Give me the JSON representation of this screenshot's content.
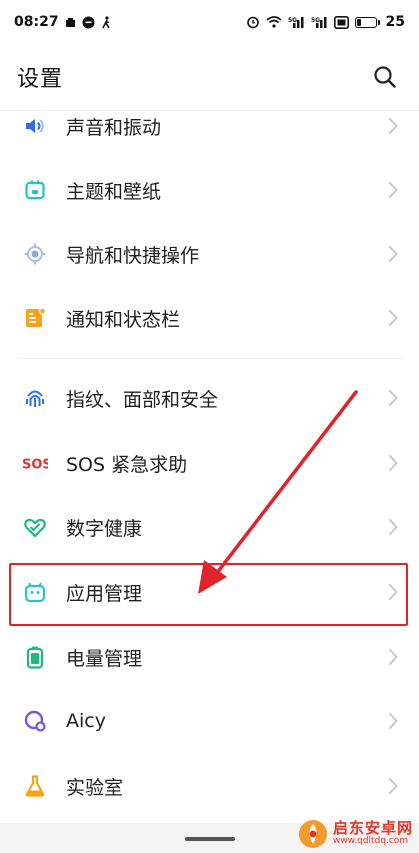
{
  "status_bar": {
    "time": "08:27",
    "battery_level": "25",
    "battery_fraction": 0.25
  },
  "header": {
    "title": "设置"
  },
  "items": [
    {
      "label": "声音和振动",
      "icon": "speaker-icon",
      "color": "#2f6fe8"
    },
    {
      "label": "主题和壁纸",
      "icon": "theme-icon",
      "color": "#1ec6c9"
    },
    {
      "label": "导航和快捷操作",
      "icon": "navigation-icon",
      "color": "#8aa7d8"
    },
    {
      "label": "通知和状态栏",
      "icon": "notification-icon",
      "color": "#f6a21a"
    },
    {
      "label": "指纹、面部和安全",
      "icon": "fingerprint-icon",
      "color": "#2f6fe8"
    },
    {
      "label": "SOS 紧急求助",
      "icon": "sos-icon",
      "icon_text": "SOS",
      "color": "#e33030"
    },
    {
      "label": "数字健康",
      "icon": "digital-health-icon",
      "color": "#1fba7d"
    },
    {
      "label": "应用管理",
      "icon": "app-management-icon",
      "color": "#27c4c9"
    },
    {
      "label": "电量管理",
      "icon": "battery-management-icon",
      "color": "#1fba7d"
    },
    {
      "label": "Aicy",
      "icon": "aicy-icon",
      "color": "#7a55e0"
    },
    {
      "label": "实验室",
      "icon": "lab-icon",
      "color": "#f2a51c"
    }
  ],
  "highlighted_item": "应用管理",
  "annotation_color": "#e0242c",
  "watermark": {
    "name": "启东安卓网",
    "url": "www.qdltdq.com"
  }
}
